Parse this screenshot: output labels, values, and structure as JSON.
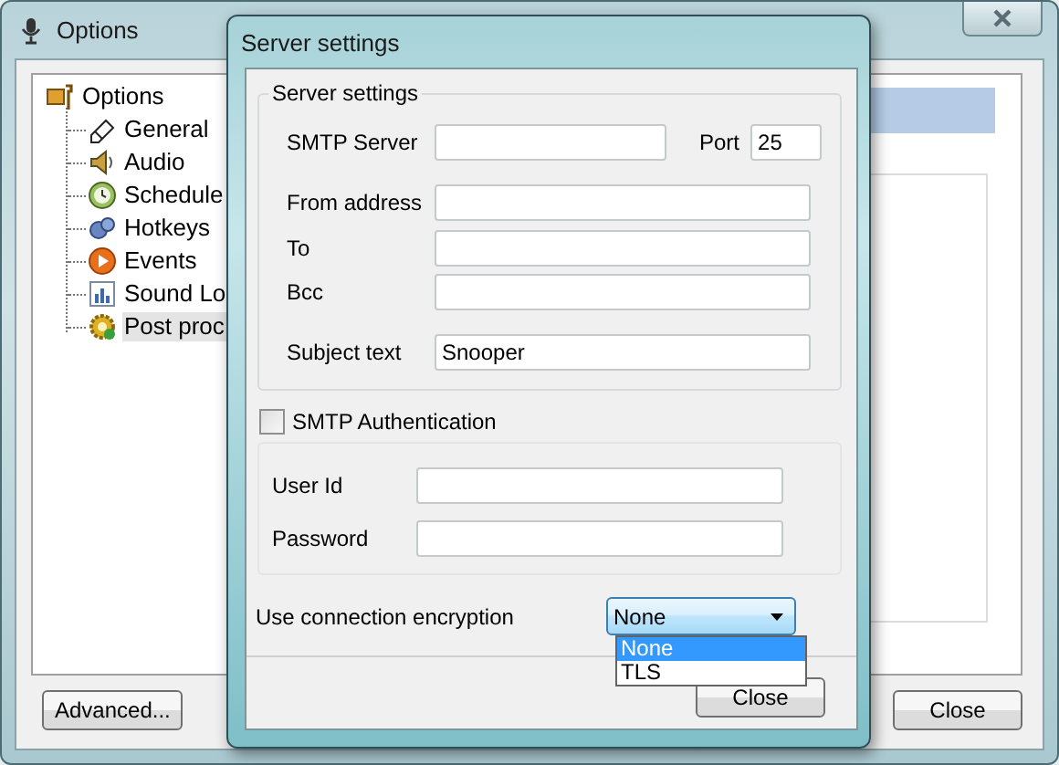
{
  "options_window": {
    "title": "Options",
    "tree": {
      "label": "Options",
      "expanded": true,
      "children": [
        {
          "label": "General",
          "selected": false
        },
        {
          "label": "Audio",
          "selected": false
        },
        {
          "label": "Schedule",
          "selected": false
        },
        {
          "label": "Hotkeys",
          "selected": false
        },
        {
          "label": "Events",
          "selected": false
        },
        {
          "label": "Sound Lo",
          "selected": false
        },
        {
          "label": "Post proc",
          "selected": true
        }
      ]
    },
    "buttons": [
      "Advanced...",
      "Close"
    ]
  },
  "server_dialog": {
    "title": "Server settings",
    "server_group": {
      "title": "Server settings",
      "fields": [
        {
          "label": "SMTP Server"
        },
        {
          "label": "From address"
        },
        {
          "label": "To"
        },
        {
          "label": "Bcc"
        },
        {
          "label": "Subject text",
          "value": "Snooper"
        }
      ],
      "port": {
        "label": "Port",
        "value": "25"
      }
    },
    "authentication": {
      "label": "SMTP Authentication",
      "checked": false,
      "fields": [
        {
          "label": "User Id"
        },
        {
          "label": "Password"
        }
      ]
    },
    "encryption": {
      "label": "Use connection encryption",
      "value": "None",
      "expanded": true,
      "options": [
        {
          "label": "None",
          "selected": true
        },
        {
          "label": "TLS",
          "selected": false
        }
      ]
    },
    "buttons": [
      "Close"
    ]
  }
}
